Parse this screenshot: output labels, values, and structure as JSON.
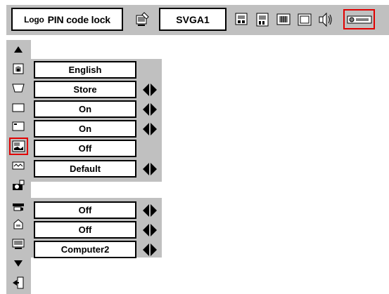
{
  "header": {
    "title_logo": "Logo",
    "title_main": "PIN code lock",
    "signal": "SVGA1",
    "icons": [
      "pc-adjust-icon",
      "image-select-icon",
      "image-adjust-icon",
      "screen-icon",
      "sound-icon",
      "setting-icon"
    ]
  },
  "sidebar": {
    "icons": [
      "scroll-up-icon",
      "language-icon",
      "keystone-icon",
      "blue-back-icon",
      "display-icon",
      "logo-icon",
      "ceiling-icon",
      "lamp-icon",
      "power-management-icon",
      "remote-icon",
      "input-icon",
      "scroll-down-icon",
      "exit-icon"
    ]
  },
  "rows": [
    {
      "name": "language-value",
      "value": "English",
      "arrows": false
    },
    {
      "name": "keystone-value",
      "value": "Store",
      "arrows": true
    },
    {
      "name": "blue-back-value",
      "value": "On",
      "arrows": true
    },
    {
      "name": "display-value",
      "value": "On",
      "arrows": true
    },
    {
      "name": "logo-value",
      "value": "Off",
      "arrows": false
    },
    {
      "name": "ceiling-value",
      "value": "Default",
      "arrows": true
    },
    {
      "name": "power-management-value",
      "value": "Off",
      "arrows": true
    },
    {
      "name": "remote-value",
      "value": "Off",
      "arrows": true
    },
    {
      "name": "input-value",
      "value": "Computer2",
      "arrows": true
    }
  ],
  "colors": {
    "panel": "#c0c0c0",
    "selection": "#e00000"
  }
}
